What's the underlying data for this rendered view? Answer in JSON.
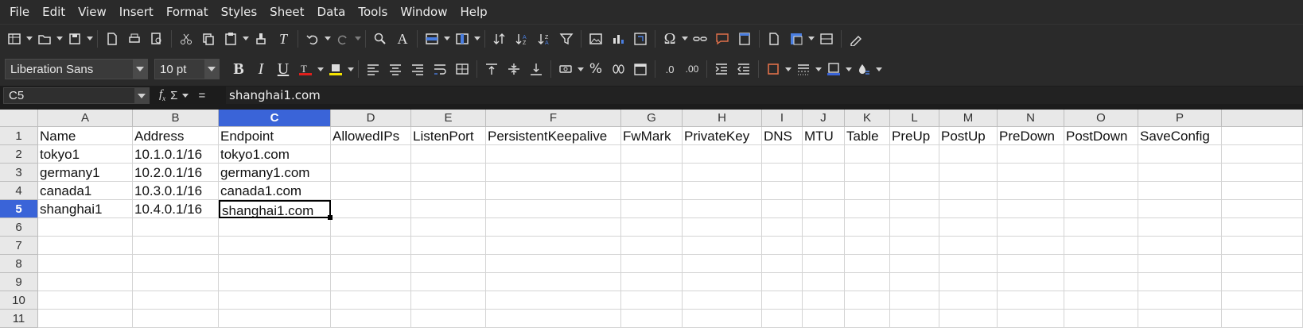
{
  "menu": [
    "File",
    "Edit",
    "View",
    "Insert",
    "Format",
    "Styles",
    "Sheet",
    "Data",
    "Tools",
    "Window",
    "Help"
  ],
  "formatting": {
    "font_name": "Liberation Sans",
    "font_size": "10 pt",
    "bold": "B",
    "italic": "I",
    "underline": "U",
    "percent": "%",
    "decimal_add": ".0",
    "decimal_remove": ".00"
  },
  "formula_bar": {
    "cell_ref": "C5",
    "fx": "f",
    "sum": "Σ",
    "equals": "=",
    "content": "shanghai1.com"
  },
  "columns": [
    "A",
    "B",
    "C",
    "D",
    "E",
    "F",
    "G",
    "H",
    "I",
    "J",
    "K",
    "L",
    "M",
    "N",
    "O",
    "P"
  ],
  "selected_column": "C",
  "row_numbers": [
    "1",
    "2",
    "3",
    "4",
    "5",
    "6",
    "7",
    "8",
    "9",
    "10",
    "11"
  ],
  "selected_row": "5",
  "rows": [
    [
      "Name",
      "Address",
      "Endpoint",
      "AllowedIPs",
      "ListenPort",
      "PersistentKeepalive",
      "FwMark",
      "PrivateKey",
      "DNS",
      "MTU",
      "Table",
      "PreUp",
      "PostUp",
      "PreDown",
      "PostDown",
      "SaveConfig"
    ],
    [
      "tokyo1",
      "10.1.0.1/16",
      "tokyo1.com",
      "",
      "",
      "",
      "",
      "",
      "",
      "",
      "",
      "",
      "",
      "",
      "",
      ""
    ],
    [
      "germany1",
      "10.2.0.1/16",
      "germany1.com",
      "",
      "",
      "",
      "",
      "",
      "",
      "",
      "",
      "",
      "",
      "",
      "",
      ""
    ],
    [
      "canada1",
      "10.3.0.1/16",
      "canada1.com",
      "",
      "",
      "",
      "",
      "",
      "",
      "",
      "",
      "",
      "",
      "",
      "",
      ""
    ],
    [
      "shanghai1",
      "10.4.0.1/16",
      "shanghai1.com",
      "",
      "",
      "",
      "",
      "",
      "",
      "",
      "",
      "",
      "",
      "",
      "",
      ""
    ]
  ],
  "colors": {
    "selection": "#3a64d8",
    "font_color_bar": "#e0201c",
    "highlight_bar": "#f5e400",
    "border_accent": "#e0704a"
  }
}
